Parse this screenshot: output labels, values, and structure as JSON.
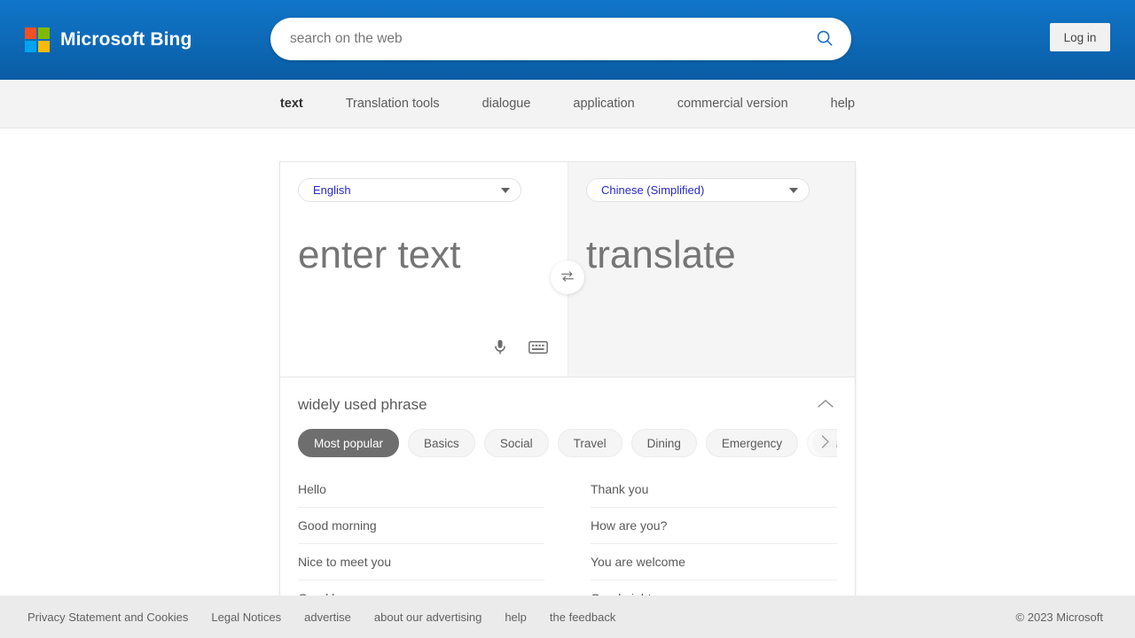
{
  "header": {
    "brand": "Microsoft Bing",
    "logo_icon": "microsoft-logo-icon",
    "logo_colors": [
      "#f25022",
      "#7fba00",
      "#00a4ef",
      "#ffb900"
    ],
    "accent_color": "#0a5ca4",
    "search": {
      "placeholder": "search on the web",
      "value": "",
      "icon": "search-icon"
    },
    "login_label": "Log in"
  },
  "nav": {
    "items": [
      {
        "label": "text",
        "active": true
      },
      {
        "label": "Translation tools",
        "active": false
      },
      {
        "label": "dialogue",
        "active": false
      },
      {
        "label": "application",
        "active": false
      },
      {
        "label": "commercial version",
        "active": false
      },
      {
        "label": "help",
        "active": false
      }
    ]
  },
  "translator": {
    "source": {
      "language": "English",
      "placeholder": "enter text",
      "value": "",
      "mic_icon": "microphone-icon",
      "keyboard_icon": "keyboard-icon"
    },
    "target": {
      "language": "Chinese (Simplified)",
      "placeholder": "translate",
      "value": ""
    },
    "swap_icon": "swap-languages-icon",
    "language_text_color": "#2727cf"
  },
  "phrases": {
    "title": "widely used phrase",
    "collapse_icon": "chevron-up-icon",
    "next_icon": "chevron-right-icon",
    "categories": [
      {
        "label": "Most popular",
        "active": true
      },
      {
        "label": "Basics",
        "active": false
      },
      {
        "label": "Social",
        "active": false
      },
      {
        "label": "Travel",
        "active": false
      },
      {
        "label": "Dining",
        "active": false
      },
      {
        "label": "Emergency",
        "active": false
      },
      {
        "label": "Dates",
        "active": false
      }
    ],
    "column_left": [
      "Hello",
      "Good morning",
      "Nice to meet you",
      "Good bye"
    ],
    "column_right": [
      "Thank you",
      "How are you?",
      "You are welcome",
      "Good night"
    ]
  },
  "footer": {
    "links": [
      "Privacy Statement and Cookies",
      "Legal Notices",
      "advertise",
      "about our advertising",
      "help",
      "the feedback"
    ],
    "copyright": "© 2023 Microsoft"
  }
}
